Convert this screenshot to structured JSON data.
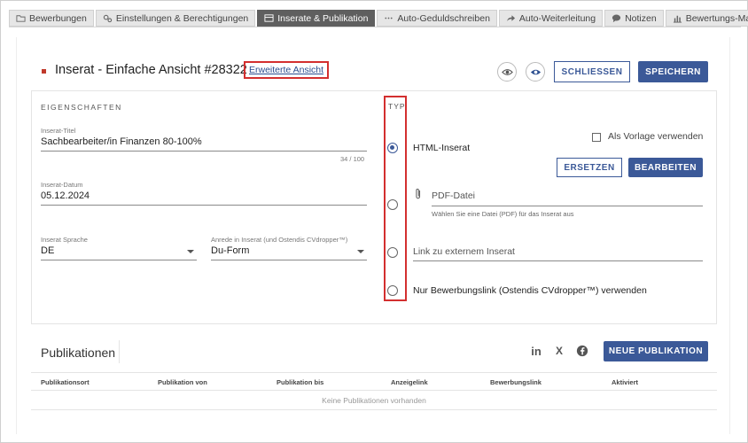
{
  "tabs": [
    {
      "label": "Bewerbungen",
      "icon": "folder-icon",
      "active": false
    },
    {
      "label": "Einstellungen & Berechtigungen",
      "icon": "gears-icon",
      "active": false
    },
    {
      "label": "Inserate & Publikation",
      "icon": "window-icon",
      "active": true
    },
    {
      "label": "Auto-Geduldschreiben",
      "icon": "dots-icon",
      "active": false
    },
    {
      "label": "Auto-Weiterleitung",
      "icon": "forward-icon",
      "active": false
    },
    {
      "label": "Notizen",
      "icon": "comment-icon",
      "active": false
    },
    {
      "label": "Bewertungs-Matrix",
      "icon": "chart-icon",
      "active": false
    }
  ],
  "header": {
    "title": "Inserat - Einfache Ansicht #28322",
    "extended_view_link": "Erweiterte Ansicht",
    "close_label": "SCHLIESSEN",
    "save_label": "SPEICHERN",
    "accent_color": "#3b5998",
    "marker_color": "#c0392b"
  },
  "properties": {
    "section_label": "EIGENSCHAFTEN",
    "title_field": {
      "label": "Inserat-Titel",
      "value": "Sachbearbeiter/in Finanzen 80-100%",
      "counter": "34 / 100"
    },
    "date_field": {
      "label": "Inserat-Datum",
      "value": "05.12.2024"
    },
    "language_field": {
      "label": "Inserat Sprache",
      "value": "DE"
    },
    "salutation_field": {
      "label": "Anrede in Inserat (und Ostendis CVdropper™)",
      "value": "Du-Form"
    }
  },
  "typ": {
    "label": "TYP",
    "html_option": "HTML-Inserat",
    "template_checkbox": "Als Vorlage verwenden",
    "replace_label": "ERSETZEN",
    "edit_label": "BEARBEITEN",
    "pdf_placeholder": "PDF-Datei",
    "pdf_hint": "Wählen Sie eine Datei (PDF) für das Inserat aus",
    "link_placeholder": "Link zu externem Inserat",
    "apply_only_option": "Nur Bewerbungslink (Ostendis CVdropper™) verwenden"
  },
  "publications": {
    "title": "Publikationen",
    "new_label": "NEUE PUBLIKATION",
    "social": {
      "linkedin": "in",
      "xing": "X"
    },
    "columns": [
      "Publikationsort",
      "Publikation von",
      "Publikation bis",
      "Anzeigelink",
      "Bewerbungslink",
      "Aktiviert"
    ],
    "empty_text": "Keine Publikationen vorhanden"
  }
}
